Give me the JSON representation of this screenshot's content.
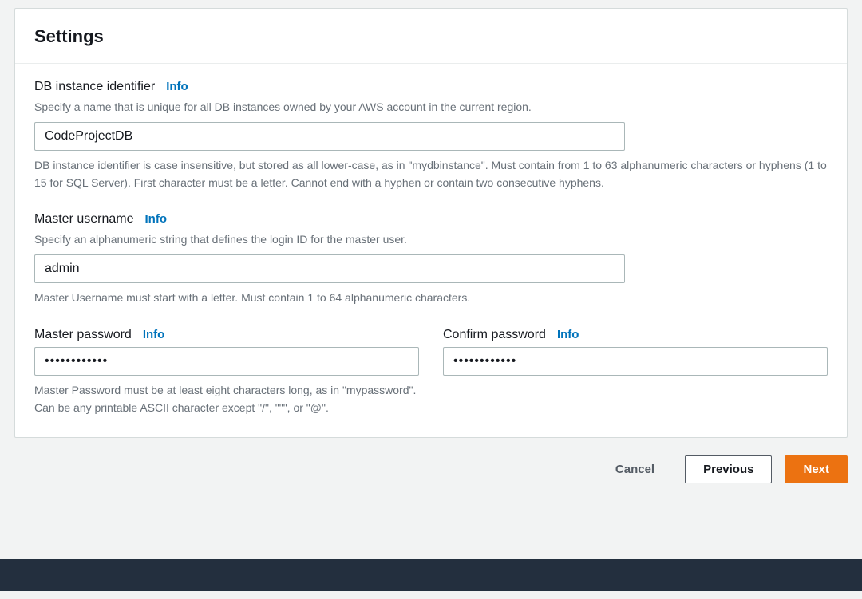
{
  "panel": {
    "title": "Settings"
  },
  "fields": {
    "dbInstance": {
      "label": "DB instance identifier",
      "info": "Info",
      "desc": "Specify a name that is unique for all DB instances owned by your AWS account in the current region.",
      "value": "CodeProjectDB",
      "helper": "DB instance identifier is case insensitive, but stored as all lower-case, as in \"mydbinstance\". Must contain from 1 to 63 alphanumeric characters or hyphens (1 to 15 for SQL Server). First character must be a letter. Cannot end with a hyphen or contain two consecutive hyphens."
    },
    "masterUser": {
      "label": "Master username",
      "info": "Info",
      "desc": "Specify an alphanumeric string that defines the login ID for the master user.",
      "value": "admin",
      "helper": "Master Username must start with a letter. Must contain 1 to 64 alphanumeric characters."
    },
    "masterPassword": {
      "label": "Master password",
      "info": "Info",
      "value": "••••••••••••",
      "helper": "Master Password must be at least eight characters long, as in \"mypassword\". Can be any printable ASCII character except \"/\", \"\"\", or \"@\"."
    },
    "confirmPassword": {
      "label": "Confirm password",
      "info": "Info",
      "value": "••••••••••••"
    }
  },
  "actions": {
    "cancel": "Cancel",
    "previous": "Previous",
    "next": "Next"
  }
}
